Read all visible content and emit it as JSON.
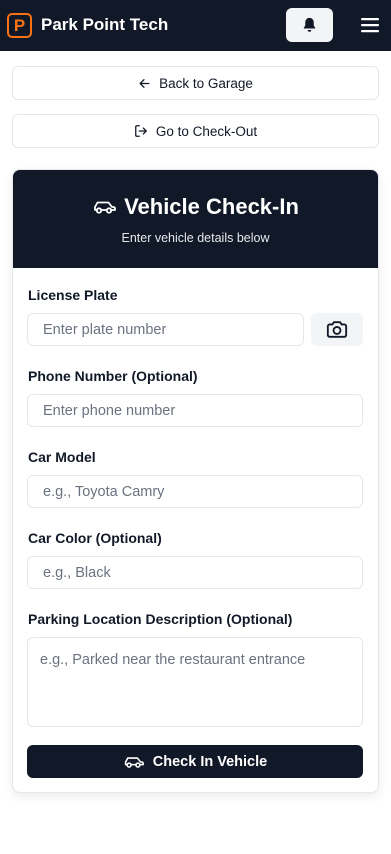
{
  "app": {
    "logo_letter": "P",
    "title": "Park Point Tech"
  },
  "header": {
    "notification_icon": "bell-icon",
    "menu_icon": "hamburger-menu-icon"
  },
  "nav": {
    "back_label": "Back to Garage",
    "back_icon": "arrow-left-icon",
    "checkout_label": "Go to Check-Out",
    "checkout_icon": "log-out-icon"
  },
  "form": {
    "title": "Vehicle Check-In",
    "title_icon": "car-icon",
    "subtitle": "Enter vehicle details below",
    "license_plate": {
      "label": "License Plate",
      "placeholder": "Enter plate number",
      "value": "",
      "camera_icon": "camera-icon"
    },
    "phone": {
      "label": "Phone Number (Optional)",
      "placeholder": "Enter phone number",
      "value": ""
    },
    "car_model": {
      "label": "Car Model",
      "placeholder": "e.g., Toyota Camry",
      "value": ""
    },
    "car_color": {
      "label": "Car Color (Optional)",
      "placeholder": "e.g., Black",
      "value": ""
    },
    "location": {
      "label": "Parking Location Description (Optional)",
      "placeholder": "e.g., Parked near the restaurant entrance",
      "value": ""
    },
    "submit_label": "Check In Vehicle",
    "submit_icon": "car-icon"
  },
  "colors": {
    "primary": "#111827",
    "accent": "#f97316",
    "border": "#e5e7eb",
    "muted_bg": "#f3f4f6",
    "placeholder": "#6b7280"
  }
}
